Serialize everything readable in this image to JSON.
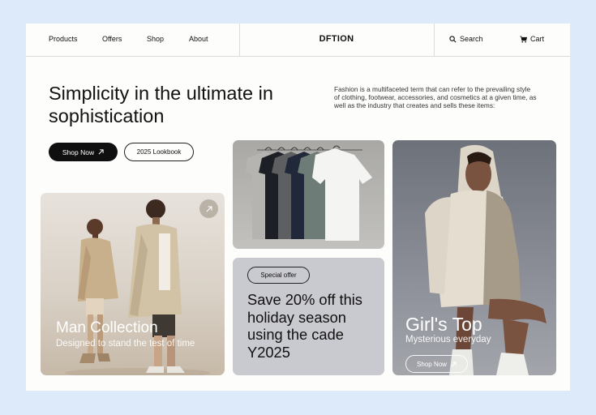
{
  "nav": {
    "links": [
      "Products",
      "Offers",
      "Shop",
      "About"
    ],
    "logo": "DFTION",
    "search_label": "Search",
    "cart_label": "Cart"
  },
  "hero": {
    "headline": "Simplicity in the ultimate in sophistication",
    "description": "Fashion is a multifaceted term that can refer to the prevailing style of clothing, footwear, accessories, and cosmetics at a given time, as well as the industry that creates and sells these items:",
    "primary_button": "Shop Now",
    "secondary_button": "2025 Lookbook"
  },
  "cards": {
    "man": {
      "title": "Man Collection",
      "subtitle": "Designed to stand the test of time"
    },
    "offer": {
      "badge": "Special offer",
      "text": "Save 20% off this holiday season using the cade Y2025"
    },
    "girl": {
      "title": "Girl's Top",
      "subtitle": "Mysterious everyday",
      "button": "Shop Now"
    }
  },
  "colors": {
    "accent": "#0f0f0f",
    "background": "#dceafa",
    "page": "#fdfdfb",
    "offer_card": "#c9c9d0"
  },
  "icons": {
    "search": "search-icon",
    "cart": "cart-icon",
    "arrow": "arrow-up-right-icon"
  }
}
